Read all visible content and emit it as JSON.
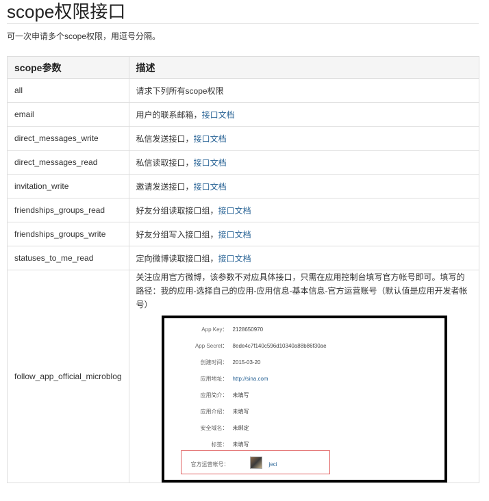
{
  "title": "scope权限接口",
  "intro": "可一次申请多个scope权限，用逗号分隔。",
  "table": {
    "headers": [
      "scope参数",
      "描述"
    ],
    "rows": [
      {
        "param": "all",
        "desc": "请求下列所有scope权限",
        "link": ""
      },
      {
        "param": "email",
        "desc": "用户的联系邮箱，",
        "link": "接口文档"
      },
      {
        "param": "direct_messages_write",
        "desc": "私信发送接口，",
        "link": "接口文档"
      },
      {
        "param": "direct_messages_read",
        "desc": "私信读取接口，",
        "link": "接口文档"
      },
      {
        "param": "invitation_write",
        "desc": "邀请发送接口，",
        "link": "接口文档"
      },
      {
        "param": "friendships_groups_read",
        "desc": "好友分组读取接口组，",
        "link": "接口文档"
      },
      {
        "param": "friendships_groups_write",
        "desc": "好友分组写入接口组，",
        "link": "接口文档"
      },
      {
        "param": "statuses_to_me_read",
        "desc": "定向微博读取接口组，",
        "link": "接口文档"
      }
    ],
    "last_row": {
      "param": "follow_app_official_microblog",
      "desc": "关注应用官方微博，该参数不对应具体接口，只需在应用控制台填写官方帐号即可。填写的路径：我的应用-选择自己的应用-应用信息-基本信息-官方运营账号（默认值是应用开发者帐号）"
    }
  },
  "screenshot": {
    "fields": [
      {
        "key": "App Key：",
        "value": "2128650970",
        "is_link": false
      },
      {
        "key": "App Secret：",
        "value": "8ede4c7f140c596d10340a88b86f30ae",
        "is_link": false
      },
      {
        "key": "创建时间：",
        "value": "2015-03-20",
        "is_link": false
      },
      {
        "key": "应用地址：",
        "value": "http://sina.com",
        "is_link": true
      },
      {
        "key": "应用简介：",
        "value": "未填写",
        "is_link": false
      },
      {
        "key": "应用介绍：",
        "value": "未填写",
        "is_link": false
      },
      {
        "key": "安全域名：",
        "value": "未绑定",
        "is_link": false
      },
      {
        "key": "标签：",
        "value": "未填写",
        "is_link": false
      }
    ],
    "official_account": {
      "key": "官方运营帐号：",
      "value": "jeci"
    }
  }
}
